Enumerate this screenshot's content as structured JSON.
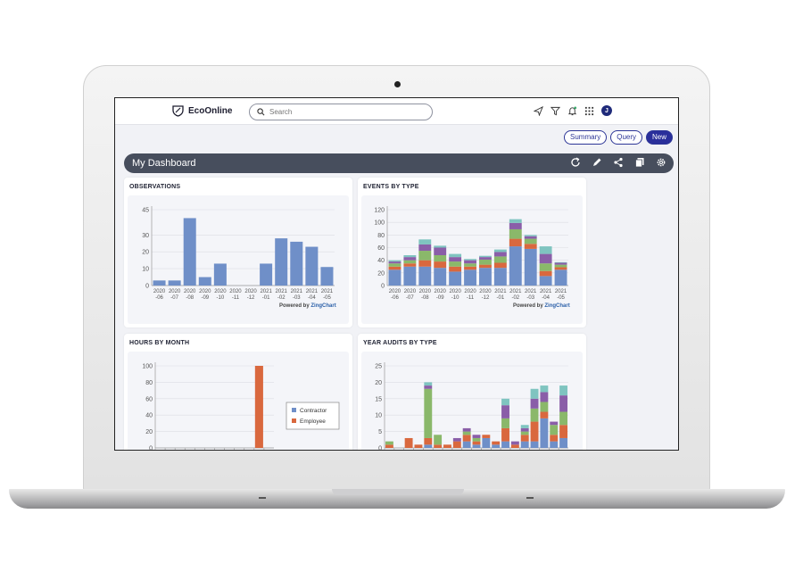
{
  "header": {
    "brand": "EcoOnline",
    "search_placeholder": "Search",
    "avatar_initial": "J"
  },
  "actions": {
    "summary": "Summary",
    "query": "Query",
    "new": "New"
  },
  "dashboard": {
    "title": "My Dashboard"
  },
  "colors": {
    "blue": "#6f8fc8",
    "orange": "#d9683e",
    "green": "#8ab86a",
    "purple": "#8a5ea8",
    "teal": "#7fc4c0",
    "yellow": "#f2c84b",
    "pink": "#d986b4",
    "dashbar": "#474e5d",
    "accent": "#2a2f9b"
  },
  "powered_by": {
    "prefix": "Powered by",
    "brand": "ZingChart"
  },
  "chart_data": [
    {
      "type": "bar",
      "title": "OBSERVATIONS",
      "categories": [
        "2020\n-06",
        "2020\n-07",
        "2020\n-08",
        "2020\n-09",
        "2020\n-10",
        "2020\n-11",
        "2020\n-12",
        "2021\n-01",
        "2021\n-02",
        "2021\n-03",
        "2021\n-04",
        "2021\n-05"
      ],
      "values": [
        3,
        3,
        40,
        5,
        13,
        0,
        0,
        13,
        28,
        26,
        23,
        11
      ],
      "yticks": [
        0,
        10,
        20,
        30,
        45
      ],
      "ylim": [
        0,
        45
      ]
    },
    {
      "type": "bar",
      "stacked": true,
      "title": "EVENTS BY TYPE",
      "categories": [
        "2020\n-06",
        "2020\n-07",
        "2020\n-08",
        "2020\n-09",
        "2020\n-10",
        "2020\n-11",
        "2020\n-12",
        "2021\n-01",
        "2021\n-02",
        "2021\n-03",
        "2021\n-04",
        "2021\n-05"
      ],
      "series": [
        {
          "values": [
            25,
            30,
            30,
            28,
            22,
            25,
            28,
            28,
            62,
            58,
            15,
            25
          ]
        },
        {
          "values": [
            5,
            5,
            10,
            10,
            8,
            5,
            5,
            8,
            12,
            8,
            8,
            4
          ]
        },
        {
          "values": [
            5,
            5,
            15,
            10,
            8,
            5,
            8,
            10,
            15,
            8,
            12,
            4
          ]
        },
        {
          "values": [
            3,
            5,
            10,
            12,
            7,
            5,
            4,
            7,
            10,
            4,
            15,
            3
          ]
        },
        {
          "values": [
            2,
            3,
            8,
            3,
            5,
            2,
            2,
            4,
            6,
            2,
            12,
            1
          ]
        }
      ],
      "yticks": [
        0,
        20,
        40,
        60,
        80,
        100,
        120
      ],
      "ylim": [
        0,
        120
      ]
    },
    {
      "type": "bar",
      "title": "HOURS BY MONTH",
      "categories": [
        "",
        "",
        "",
        "",
        "",
        "",
        "",
        "",
        "",
        "",
        "",
        ""
      ],
      "series": [
        {
          "name": "Contractor",
          "values": [
            0,
            0,
            0,
            0,
            0,
            0,
            0,
            0,
            0,
            0,
            0,
            0
          ]
        },
        {
          "name": "Employee",
          "values": [
            0,
            0,
            0,
            0,
            0,
            0,
            0,
            0,
            0,
            0,
            100,
            0
          ]
        }
      ],
      "yticks": [
        0,
        20,
        40,
        60,
        80,
        100
      ],
      "ylim": [
        0,
        100
      ]
    },
    {
      "type": "bar",
      "stacked": true,
      "title": "YEAR AUDITS BY TYPE",
      "categories": [
        "",
        "",
        "",
        "",
        "",
        "",
        "",
        "",
        "",
        "",
        "",
        "",
        "",
        "",
        "",
        "",
        "",
        "",
        ""
      ],
      "series": [
        {
          "values": [
            0,
            0,
            0,
            0,
            1,
            0,
            0,
            0,
            2,
            1,
            3,
            1,
            2,
            0,
            2,
            2,
            9,
            2,
            3
          ]
        },
        {
          "values": [
            1,
            0,
            3,
            1,
            2,
            1,
            1,
            2,
            2,
            1,
            1,
            1,
            4,
            1,
            2,
            6,
            2,
            2,
            4
          ]
        },
        {
          "values": [
            1,
            0,
            0,
            0,
            15,
            3,
            0,
            0,
            1,
            1,
            0,
            0,
            3,
            0,
            1,
            4,
            3,
            3,
            4
          ]
        },
        {
          "values": [
            0,
            0,
            0,
            0,
            1,
            0,
            0,
            1,
            1,
            1,
            0,
            0,
            4,
            1,
            1,
            3,
            3,
            1,
            5
          ]
        },
        {
          "values": [
            0,
            0,
            0,
            0,
            1,
            0,
            0,
            0,
            0,
            0,
            0,
            0,
            2,
            0,
            1,
            3,
            2,
            0,
            3
          ]
        }
      ],
      "yticks": [
        0,
        5,
        10,
        15,
        20,
        25
      ],
      "ylim": [
        0,
        25
      ]
    }
  ]
}
